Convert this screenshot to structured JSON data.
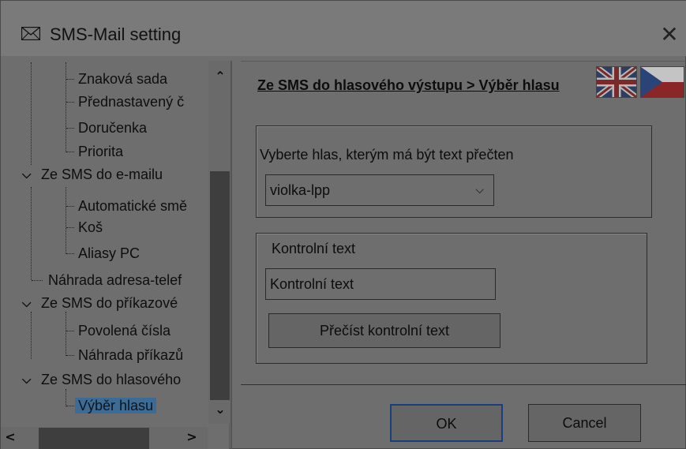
{
  "window": {
    "title": "SMS-Mail setting"
  },
  "tree": {
    "items": [
      {
        "label": "Znaková sada"
      },
      {
        "label": "Přednastavený č"
      },
      {
        "label": "Doručenka"
      },
      {
        "label": "Priorita"
      },
      {
        "label": "Ze SMS do e-mailu"
      },
      {
        "label": "Automatické smě"
      },
      {
        "label": "Koš"
      },
      {
        "label": "Aliasy PC"
      },
      {
        "label": "Náhrada adresa-telef"
      },
      {
        "label": "Ze SMS do příkazové"
      },
      {
        "label": "Povolená čísla"
      },
      {
        "label": "Náhrada příkazů"
      },
      {
        "label": "Ze SMS do hlasového"
      },
      {
        "label": "Výběr hlasu"
      }
    ]
  },
  "main": {
    "breadcrumb": "Ze SMS do hlasového výstupu  >  Výběr hlasu",
    "voice_group": {
      "label": "Vyberte hlas, kterým má být text přečten",
      "selected_voice": "violka-lpp"
    },
    "control_group": {
      "title": "Kontrolní text",
      "input_value": "Kontrolní text",
      "read_button": "Přečíst kontrolní text"
    }
  },
  "footer": {
    "ok_label": "OK",
    "cancel_label": "Cancel"
  },
  "colors": {
    "selection": "#3c6c96",
    "ok_border": "#1a3f7a"
  }
}
